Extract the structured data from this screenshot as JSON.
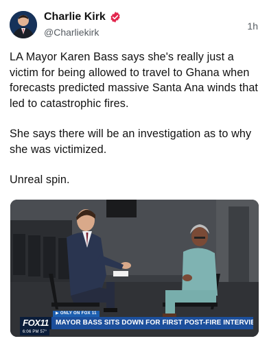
{
  "post": {
    "author_name": "Charlie Kirk",
    "handle": "@Charliekirk",
    "timestamp": "1h",
    "paragraphs": [
      "LA Mayor Karen Bass says she's really just a victim for being allowed to travel to Ghana when forecasts predicted massive Santa Ana winds that led to catastrophic fires.",
      "She says there will be an investigation as to why she was victimized.",
      "Unreal spin."
    ],
    "verified_badge_color": "#e2264d"
  },
  "video": {
    "tag": "▶ ONLY ON FOX 11",
    "brand": "FOX11",
    "headline": "MAYOR BASS SITS DOWN FOR FIRST POST-FIRE INTERVIEW",
    "clock": "6:06 PM  57°"
  },
  "icons": {
    "verified": "verified-badge-icon",
    "avatar": "avatar-photo"
  }
}
